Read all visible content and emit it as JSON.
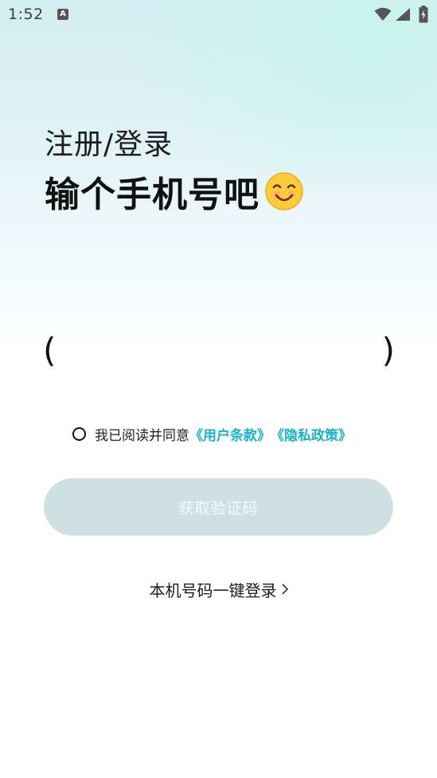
{
  "status_bar": {
    "time": "1:52",
    "notification_badge": "A"
  },
  "header": {
    "title_line1": "注册/登录",
    "title_line2": "输个手机号吧"
  },
  "phone": {
    "left_paren": "(",
    "right_paren": ")",
    "value": "",
    "placeholder": ""
  },
  "agreement": {
    "prefix": "我已阅读并同意",
    "terms_link": "《用户条款》",
    "privacy_link": "《隐私政策》",
    "accent_color": "#19b3c4"
  },
  "code_button": {
    "label": "获取验证码"
  },
  "one_click_login": {
    "label": "本机号码一键登录"
  },
  "icons": [
    "wifi-icon",
    "signal-icon",
    "battery-icon",
    "smile-icon",
    "radio-icon",
    "chevron-right-icon"
  ]
}
